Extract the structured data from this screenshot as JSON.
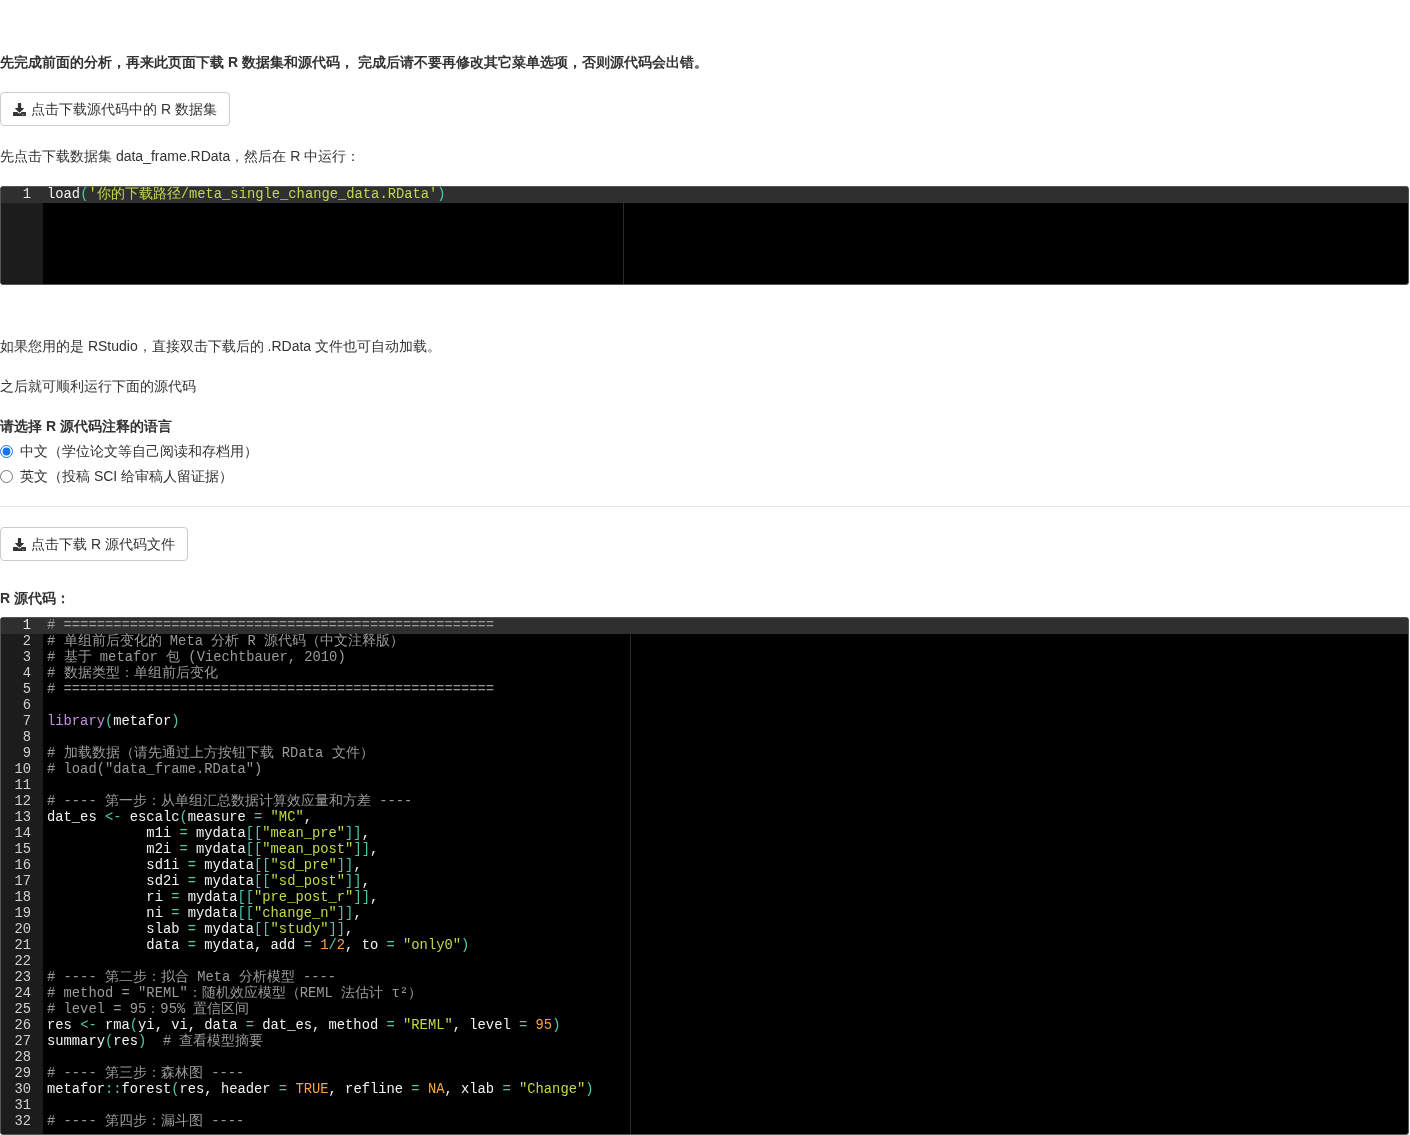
{
  "intro": "先完成前面的分析，再来此页面下载 R 数据集和源代码， 完成后请不要再修改其它菜单选项，否则源代码会出错。",
  "dataset_button": "点击下载源代码中的 R 数据集",
  "run_instruction": "先点击下载数据集 data_frame.RData，然后在 R 中运行：",
  "load_editor": {
    "lines": [
      {
        "number": "1",
        "active": true,
        "tokens": [
          {
            "kind": "plain",
            "text": "load"
          },
          {
            "kind": "op",
            "text": "("
          },
          {
            "kind": "string",
            "text": "'你的下载路径/meta_single_change_data.RData'"
          },
          {
            "kind": "op",
            "text": ")"
          }
        ]
      }
    ]
  },
  "rstudio_note": "如果您用的是 RStudio，直接双击下载后的 .RData 文件也可自动加载。",
  "after_note": "之后就可顺利运行下面的源代码",
  "language_prompt": "请选择 R 源代码注释的语言",
  "language_options": [
    {
      "label": "中文（学位论文等自己阅读和存档用）",
      "selected": true
    },
    {
      "label": "英文（投稿 SCI 给审稿人留证据）",
      "selected": false
    }
  ],
  "source_button": "点击下载 R 源代码文件",
  "source_heading": "R 源代码：",
  "source_editor": {
    "lines": [
      {
        "number": "1",
        "active": true,
        "tokens": [
          {
            "kind": "comment",
            "text": "# ===================================================="
          }
        ]
      },
      {
        "number": "2",
        "active": false,
        "tokens": [
          {
            "kind": "comment",
            "text": "# 单组前后变化的 Meta 分析 R 源代码（中文注释版）"
          }
        ]
      },
      {
        "number": "3",
        "active": false,
        "tokens": [
          {
            "kind": "comment",
            "text": "# 基于 metafor 包 (Viechtbauer, 2010)"
          }
        ]
      },
      {
        "number": "4",
        "active": false,
        "tokens": [
          {
            "kind": "comment",
            "text": "# 数据类型：单组前后变化"
          }
        ]
      },
      {
        "number": "5",
        "active": false,
        "tokens": [
          {
            "kind": "comment",
            "text": "# ===================================================="
          }
        ]
      },
      {
        "number": "6",
        "active": false
      },
      {
        "number": "7",
        "active": false,
        "tokens": [
          {
            "kind": "function",
            "text": "library"
          },
          {
            "kind": "op",
            "text": "("
          },
          {
            "kind": "plain",
            "text": "metafor"
          },
          {
            "kind": "op",
            "text": ")"
          }
        ]
      },
      {
        "number": "8",
        "active": false
      },
      {
        "number": "9",
        "active": false,
        "tokens": [
          {
            "kind": "comment",
            "text": "# 加载数据（请先通过上方按钮下载 RData 文件）"
          }
        ]
      },
      {
        "number": "10",
        "active": false,
        "tokens": [
          {
            "kind": "comment",
            "text": "# load(\"data_frame.RData\")"
          }
        ]
      },
      {
        "number": "11",
        "active": false
      },
      {
        "number": "12",
        "active": false,
        "tokens": [
          {
            "kind": "comment",
            "text": "# ---- 第一步：从单组汇总数据计算效应量和方差 ----"
          }
        ]
      },
      {
        "number": "13",
        "active": false,
        "tokens": [
          {
            "kind": "plain",
            "text": "dat_es "
          },
          {
            "kind": "op",
            "text": "<-"
          },
          {
            "kind": "plain",
            "text": " escalc"
          },
          {
            "kind": "op",
            "text": "("
          },
          {
            "kind": "plain",
            "text": "measure "
          },
          {
            "kind": "op",
            "text": "="
          },
          {
            "kind": "string",
            "text": " \"MC\""
          },
          {
            "kind": "plain",
            "text": ","
          }
        ]
      },
      {
        "number": "14",
        "active": false,
        "tokens": [
          {
            "kind": "plain",
            "text": "            m1i "
          },
          {
            "kind": "op",
            "text": "="
          },
          {
            "kind": "plain",
            "text": " mydata"
          },
          {
            "kind": "op",
            "text": "[["
          },
          {
            "kind": "string",
            "text": "\"mean_pre\""
          },
          {
            "kind": "op",
            "text": "]]"
          },
          {
            "kind": "plain",
            "text": ","
          }
        ]
      },
      {
        "number": "15",
        "active": false,
        "tokens": [
          {
            "kind": "plain",
            "text": "            m2i "
          },
          {
            "kind": "op",
            "text": "="
          },
          {
            "kind": "plain",
            "text": " mydata"
          },
          {
            "kind": "op",
            "text": "[["
          },
          {
            "kind": "string",
            "text": "\"mean_post\""
          },
          {
            "kind": "op",
            "text": "]]"
          },
          {
            "kind": "plain",
            "text": ","
          }
        ]
      },
      {
        "number": "16",
        "active": false,
        "tokens": [
          {
            "kind": "plain",
            "text": "            sd1i "
          },
          {
            "kind": "op",
            "text": "="
          },
          {
            "kind": "plain",
            "text": " mydata"
          },
          {
            "kind": "op",
            "text": "[["
          },
          {
            "kind": "string",
            "text": "\"sd_pre\""
          },
          {
            "kind": "op",
            "text": "]]"
          },
          {
            "kind": "plain",
            "text": ","
          }
        ]
      },
      {
        "number": "17",
        "active": false,
        "tokens": [
          {
            "kind": "plain",
            "text": "            sd2i "
          },
          {
            "kind": "op",
            "text": "="
          },
          {
            "kind": "plain",
            "text": " mydata"
          },
          {
            "kind": "op",
            "text": "[["
          },
          {
            "kind": "string",
            "text": "\"sd_post\""
          },
          {
            "kind": "op",
            "text": "]]"
          },
          {
            "kind": "plain",
            "text": ","
          }
        ]
      },
      {
        "number": "18",
        "active": false,
        "tokens": [
          {
            "kind": "plain",
            "text": "            ri "
          },
          {
            "kind": "op",
            "text": "="
          },
          {
            "kind": "plain",
            "text": " mydata"
          },
          {
            "kind": "op",
            "text": "[["
          },
          {
            "kind": "string",
            "text": "\"pre_post_r\""
          },
          {
            "kind": "op",
            "text": "]]"
          },
          {
            "kind": "plain",
            "text": ","
          }
        ]
      },
      {
        "number": "19",
        "active": false,
        "tokens": [
          {
            "kind": "plain",
            "text": "            ni "
          },
          {
            "kind": "op",
            "text": "="
          },
          {
            "kind": "plain",
            "text": " mydata"
          },
          {
            "kind": "op",
            "text": "[["
          },
          {
            "kind": "string",
            "text": "\"change_n\""
          },
          {
            "kind": "op",
            "text": "]]"
          },
          {
            "kind": "plain",
            "text": ","
          }
        ]
      },
      {
        "number": "20",
        "active": false,
        "tokens": [
          {
            "kind": "plain",
            "text": "            slab "
          },
          {
            "kind": "op",
            "text": "="
          },
          {
            "kind": "plain",
            "text": " mydata"
          },
          {
            "kind": "op",
            "text": "[["
          },
          {
            "kind": "string",
            "text": "\"study\""
          },
          {
            "kind": "op",
            "text": "]]"
          },
          {
            "kind": "plain",
            "text": ","
          }
        ]
      },
      {
        "number": "21",
        "active": false,
        "tokens": [
          {
            "kind": "plain",
            "text": "            data "
          },
          {
            "kind": "op",
            "text": "="
          },
          {
            "kind": "plain",
            "text": " mydata, add "
          },
          {
            "kind": "op",
            "text": "="
          },
          {
            "kind": "number",
            "text": " 1"
          },
          {
            "kind": "op",
            "text": "/"
          },
          {
            "kind": "number",
            "text": "2"
          },
          {
            "kind": "plain",
            "text": ", to "
          },
          {
            "kind": "op",
            "text": "="
          },
          {
            "kind": "string",
            "text": " \"only0\""
          },
          {
            "kind": "op",
            "text": ")"
          }
        ]
      },
      {
        "number": "22",
        "active": false
      },
      {
        "number": "23",
        "active": false,
        "tokens": [
          {
            "kind": "comment",
            "text": "# ---- 第二步：拟合 Meta 分析模型 ----"
          }
        ]
      },
      {
        "number": "24",
        "active": false,
        "tokens": [
          {
            "kind": "comment",
            "text": "# method = \"REML\"：随机效应模型（REML 法估计 τ²）"
          }
        ]
      },
      {
        "number": "25",
        "active": false,
        "tokens": [
          {
            "kind": "comment",
            "text": "# level = 95：95% 置信区间"
          }
        ]
      },
      {
        "number": "26",
        "active": false,
        "tokens": [
          {
            "kind": "plain",
            "text": "res "
          },
          {
            "kind": "op",
            "text": "<-"
          },
          {
            "kind": "plain",
            "text": " rma"
          },
          {
            "kind": "op",
            "text": "("
          },
          {
            "kind": "plain",
            "text": "yi, vi, data "
          },
          {
            "kind": "op",
            "text": "="
          },
          {
            "kind": "plain",
            "text": " dat_es, method "
          },
          {
            "kind": "op",
            "text": "="
          },
          {
            "kind": "string",
            "text": " \"REML\""
          },
          {
            "kind": "plain",
            "text": ", level "
          },
          {
            "kind": "op",
            "text": "="
          },
          {
            "kind": "number",
            "text": " 95"
          },
          {
            "kind": "op",
            "text": ")"
          }
        ]
      },
      {
        "number": "27",
        "active": false,
        "tokens": [
          {
            "kind": "plain",
            "text": "summary"
          },
          {
            "kind": "op",
            "text": "("
          },
          {
            "kind": "plain",
            "text": "res"
          },
          {
            "kind": "op",
            "text": ")"
          },
          {
            "kind": "comment",
            "text": "  # 查看模型摘要"
          }
        ]
      },
      {
        "number": "28",
        "active": false
      },
      {
        "number": "29",
        "active": false,
        "tokens": [
          {
            "kind": "comment",
            "text": "# ---- 第三步：森林图 ----"
          }
        ]
      },
      {
        "number": "30",
        "active": false,
        "tokens": [
          {
            "kind": "plain",
            "text": "metafor"
          },
          {
            "kind": "op",
            "text": "::"
          },
          {
            "kind": "plain",
            "text": "forest"
          },
          {
            "kind": "op",
            "text": "("
          },
          {
            "kind": "plain",
            "text": "res, header "
          },
          {
            "kind": "op",
            "text": "="
          },
          {
            "kind": "number",
            "text": " TRUE"
          },
          {
            "kind": "plain",
            "text": ", refline "
          },
          {
            "kind": "op",
            "text": "="
          },
          {
            "kind": "number",
            "text": " NA"
          },
          {
            "kind": "plain",
            "text": ", xlab "
          },
          {
            "kind": "op",
            "text": "="
          },
          {
            "kind": "string",
            "text": " \"Change\""
          },
          {
            "kind": "op",
            "text": ")"
          }
        ]
      },
      {
        "number": "31",
        "active": false
      },
      {
        "number": "32",
        "active": false,
        "tokens": [
          {
            "kind": "comment",
            "text": "# ---- 第四步：漏斗图 ----"
          }
        ]
      }
    ]
  }
}
